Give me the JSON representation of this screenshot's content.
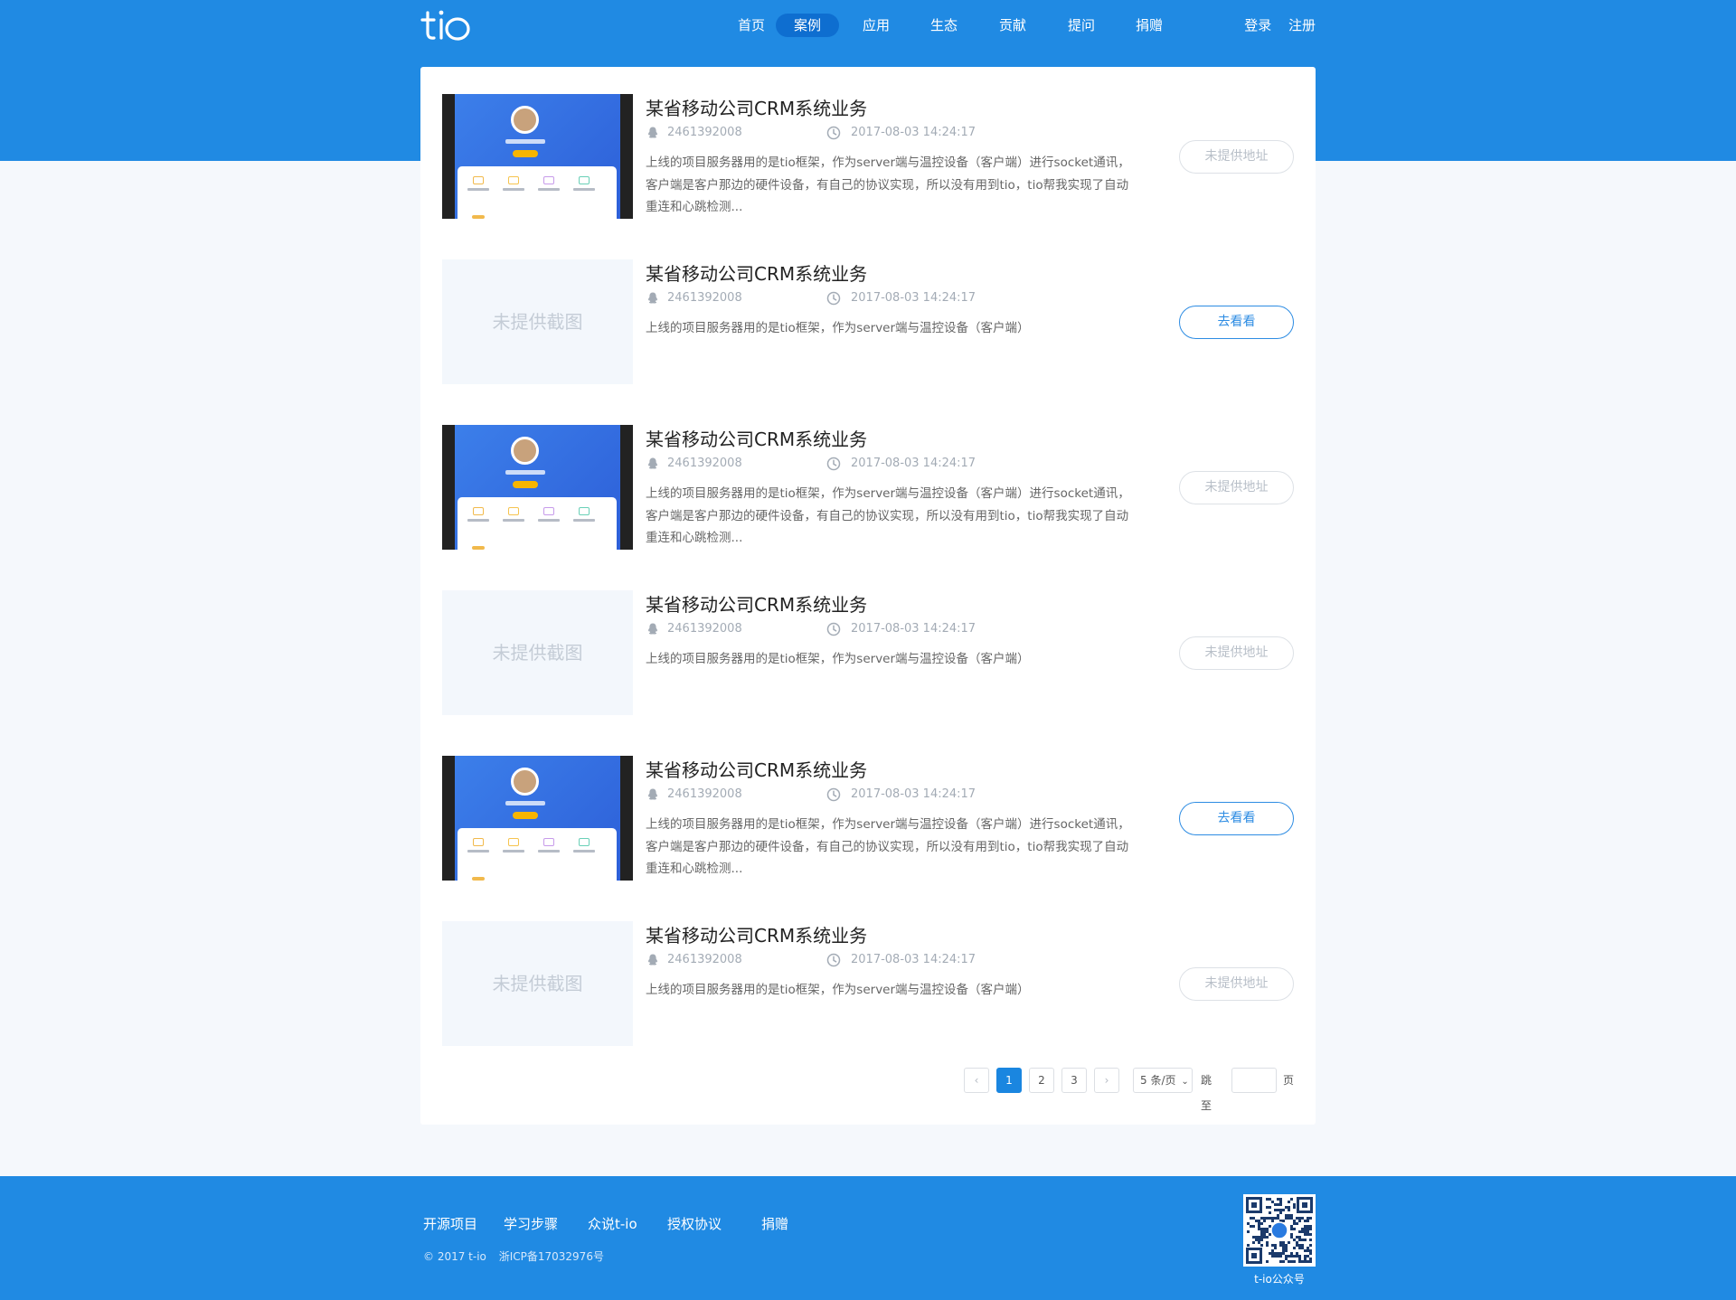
{
  "header": {
    "logo_text": "tio",
    "nav": [
      {
        "label": "首页",
        "active": false
      },
      {
        "label": "案例",
        "active": true
      },
      {
        "label": "应用",
        "active": false
      },
      {
        "label": "生态",
        "active": false
      },
      {
        "label": "贡献",
        "active": false
      },
      {
        "label": "提问",
        "active": false
      },
      {
        "label": "捐赠",
        "active": false
      }
    ],
    "login": "登录",
    "register": "注册"
  },
  "cases": [
    {
      "title": "某省移动公司CRM系统业务",
      "qq": "2461392008",
      "time": "2017-08-03 14:24:17",
      "desc": "上线的项目服务器用的是tio框架，作为server端与温控设备（客户端）进行socket通讯，客户端是客户那边的硬件设备，有自己的协议实现，所以没有用到tio，tio帮我实现了自动重连和心跳检测...",
      "has_screenshot": true,
      "button": "未提供地址",
      "button_active": false
    },
    {
      "title": "某省移动公司CRM系统业务",
      "qq": "2461392008",
      "time": "2017-08-03 14:24:17",
      "desc": "上线的项目服务器用的是tio框架，作为server端与温控设备（客户端）",
      "has_screenshot": false,
      "placeholder": "未提供截图",
      "button": "去看看",
      "button_active": true
    },
    {
      "title": "某省移动公司CRM系统业务",
      "qq": "2461392008",
      "time": "2017-08-03 14:24:17",
      "desc": "上线的项目服务器用的是tio框架，作为server端与温控设备（客户端）进行socket通讯，客户端是客户那边的硬件设备，有自己的协议实现，所以没有用到tio，tio帮我实现了自动重连和心跳检测...",
      "has_screenshot": true,
      "button": "未提供地址",
      "button_active": false
    },
    {
      "title": "某省移动公司CRM系统业务",
      "qq": "2461392008",
      "time": "2017-08-03 14:24:17",
      "desc": "上线的项目服务器用的是tio框架，作为server端与温控设备（客户端）",
      "has_screenshot": false,
      "placeholder": "未提供截图",
      "button": "未提供地址",
      "button_active": false
    },
    {
      "title": "某省移动公司CRM系统业务",
      "qq": "2461392008",
      "time": "2017-08-03 14:24:17",
      "desc": "上线的项目服务器用的是tio框架，作为server端与温控设备（客户端）进行socket通讯，客户端是客户那边的硬件设备，有自己的协议实现，所以没有用到tio，tio帮我实现了自动重连和心跳检测...",
      "has_screenshot": true,
      "button": "去看看",
      "button_active": true
    },
    {
      "title": "某省移动公司CRM系统业务",
      "qq": "2461392008",
      "time": "2017-08-03 14:24:17",
      "desc": "上线的项目服务器用的是tio框架，作为server端与温控设备（客户端）",
      "has_screenshot": false,
      "placeholder": "未提供截图",
      "button": "未提供地址",
      "button_active": false
    }
  ],
  "pagination": {
    "prev": "‹",
    "next": "›",
    "pages": [
      "1",
      "2",
      "3"
    ],
    "current": "1",
    "page_size": "5 条/页",
    "jump_label": "跳至",
    "page_unit": "页"
  },
  "footer": {
    "links": [
      "开源项目",
      "学习步骤",
      "众说t-io",
      "授权协议",
      "捐赠"
    ],
    "copyright": "© 2017 t-io",
    "icp": "浙ICP备17032976号",
    "qr_caption": "t-io公众号"
  },
  "colors": {
    "brand": "#208ae3",
    "active_nav": "#0e6ed0",
    "button_blue": "#2d8ce3"
  }
}
